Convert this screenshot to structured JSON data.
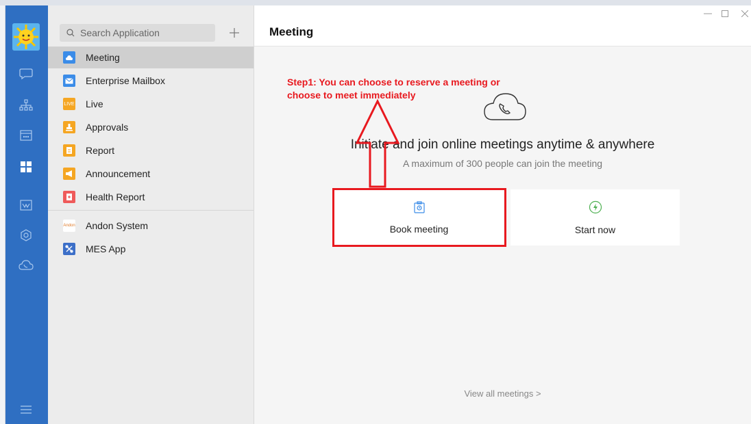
{
  "sidebar": {
    "search_placeholder": "Search Application",
    "apps": [
      {
        "label": "Meeting",
        "icon": "cloud-icon",
        "color": "#3b8ce8",
        "active": true
      },
      {
        "label": "Enterprise Mailbox",
        "icon": "mail-icon",
        "color": "#3b8ce8"
      },
      {
        "label": "Live",
        "icon": "live-icon",
        "icon_text": "LIVE",
        "color": "#f5a623"
      },
      {
        "label": "Approvals",
        "icon": "stamp-icon",
        "color": "#f5a623"
      },
      {
        "label": "Report",
        "icon": "report-icon",
        "color": "#f5a623"
      },
      {
        "label": "Announcement",
        "icon": "megaphone-icon",
        "color": "#f5a623"
      },
      {
        "label": "Health Report",
        "icon": "health-icon",
        "color": "#ef5a5a"
      },
      {
        "label": "Andon System",
        "icon": "andon-logo-icon",
        "icon_text": "Andon",
        "color": "#ffffff"
      },
      {
        "label": "MES App",
        "icon": "mes-icon",
        "color": "#3c6fc8"
      }
    ]
  },
  "main": {
    "title": "Meeting",
    "headline": "Initiate and join online meetings anytime & anywhere",
    "subline": "A maximum of 300 people can join the meeting",
    "book_label": "Book meeting",
    "start_label": "Start now",
    "view_all": "View all meetings >"
  },
  "annotation": {
    "text": "Step1: You can choose to reserve a meeting or choose to meet immediately"
  },
  "colors": {
    "rail": "#2f6fc2",
    "annotation": "#e8191f",
    "start_icon": "#4caf50",
    "book_icon": "#3b8ce8"
  }
}
